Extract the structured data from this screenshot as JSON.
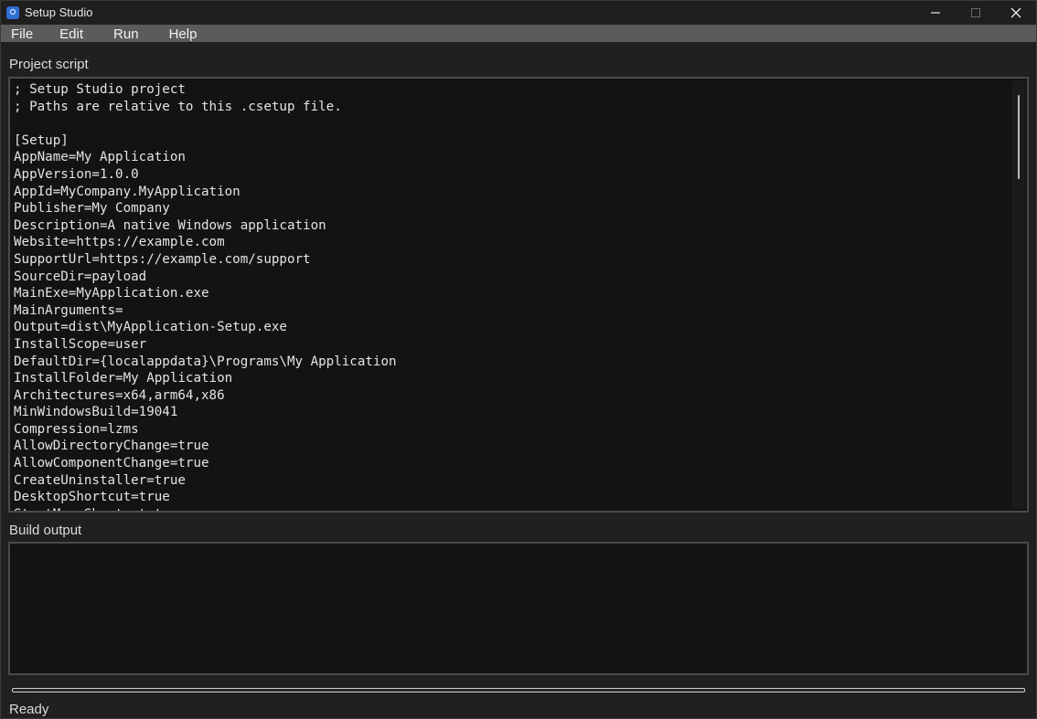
{
  "window": {
    "title": "Setup Studio"
  },
  "menu": {
    "items": [
      {
        "label": "File"
      },
      {
        "label": "Edit"
      },
      {
        "label": "Run"
      },
      {
        "label": "Help"
      }
    ]
  },
  "editor": {
    "label": "Project script",
    "lines": [
      "; Setup Studio project",
      "; Paths are relative to this .csetup file.",
      "",
      "[Setup]",
      "AppName=My Application",
      "AppVersion=1.0.0",
      "AppId=MyCompany.MyApplication",
      "Publisher=My Company",
      "Description=A native Windows application",
      "Website=https://example.com",
      "SupportUrl=https://example.com/support",
      "SourceDir=payload",
      "MainExe=MyApplication.exe",
      "MainArguments=",
      "Output=dist\\MyApplication-Setup.exe",
      "InstallScope=user",
      "DefaultDir={localappdata}\\Programs\\My Application",
      "InstallFolder=My Application",
      "Architectures=x64,arm64,x86",
      "MinWindowsBuild=19041",
      "Compression=lzms",
      "AllowDirectoryChange=true",
      "AllowComponentChange=true",
      "CreateUninstaller=true",
      "DesktopShortcut=true",
      "StartMenuShortcut=true"
    ]
  },
  "output": {
    "label": "Build output",
    "text": ""
  },
  "progress": {
    "value": 0
  },
  "status": {
    "text": "Ready"
  },
  "colors": {
    "background": "#202020",
    "menubar": "#5b5b5b",
    "editor_bg": "#131313",
    "text": "#e4e4e4"
  }
}
